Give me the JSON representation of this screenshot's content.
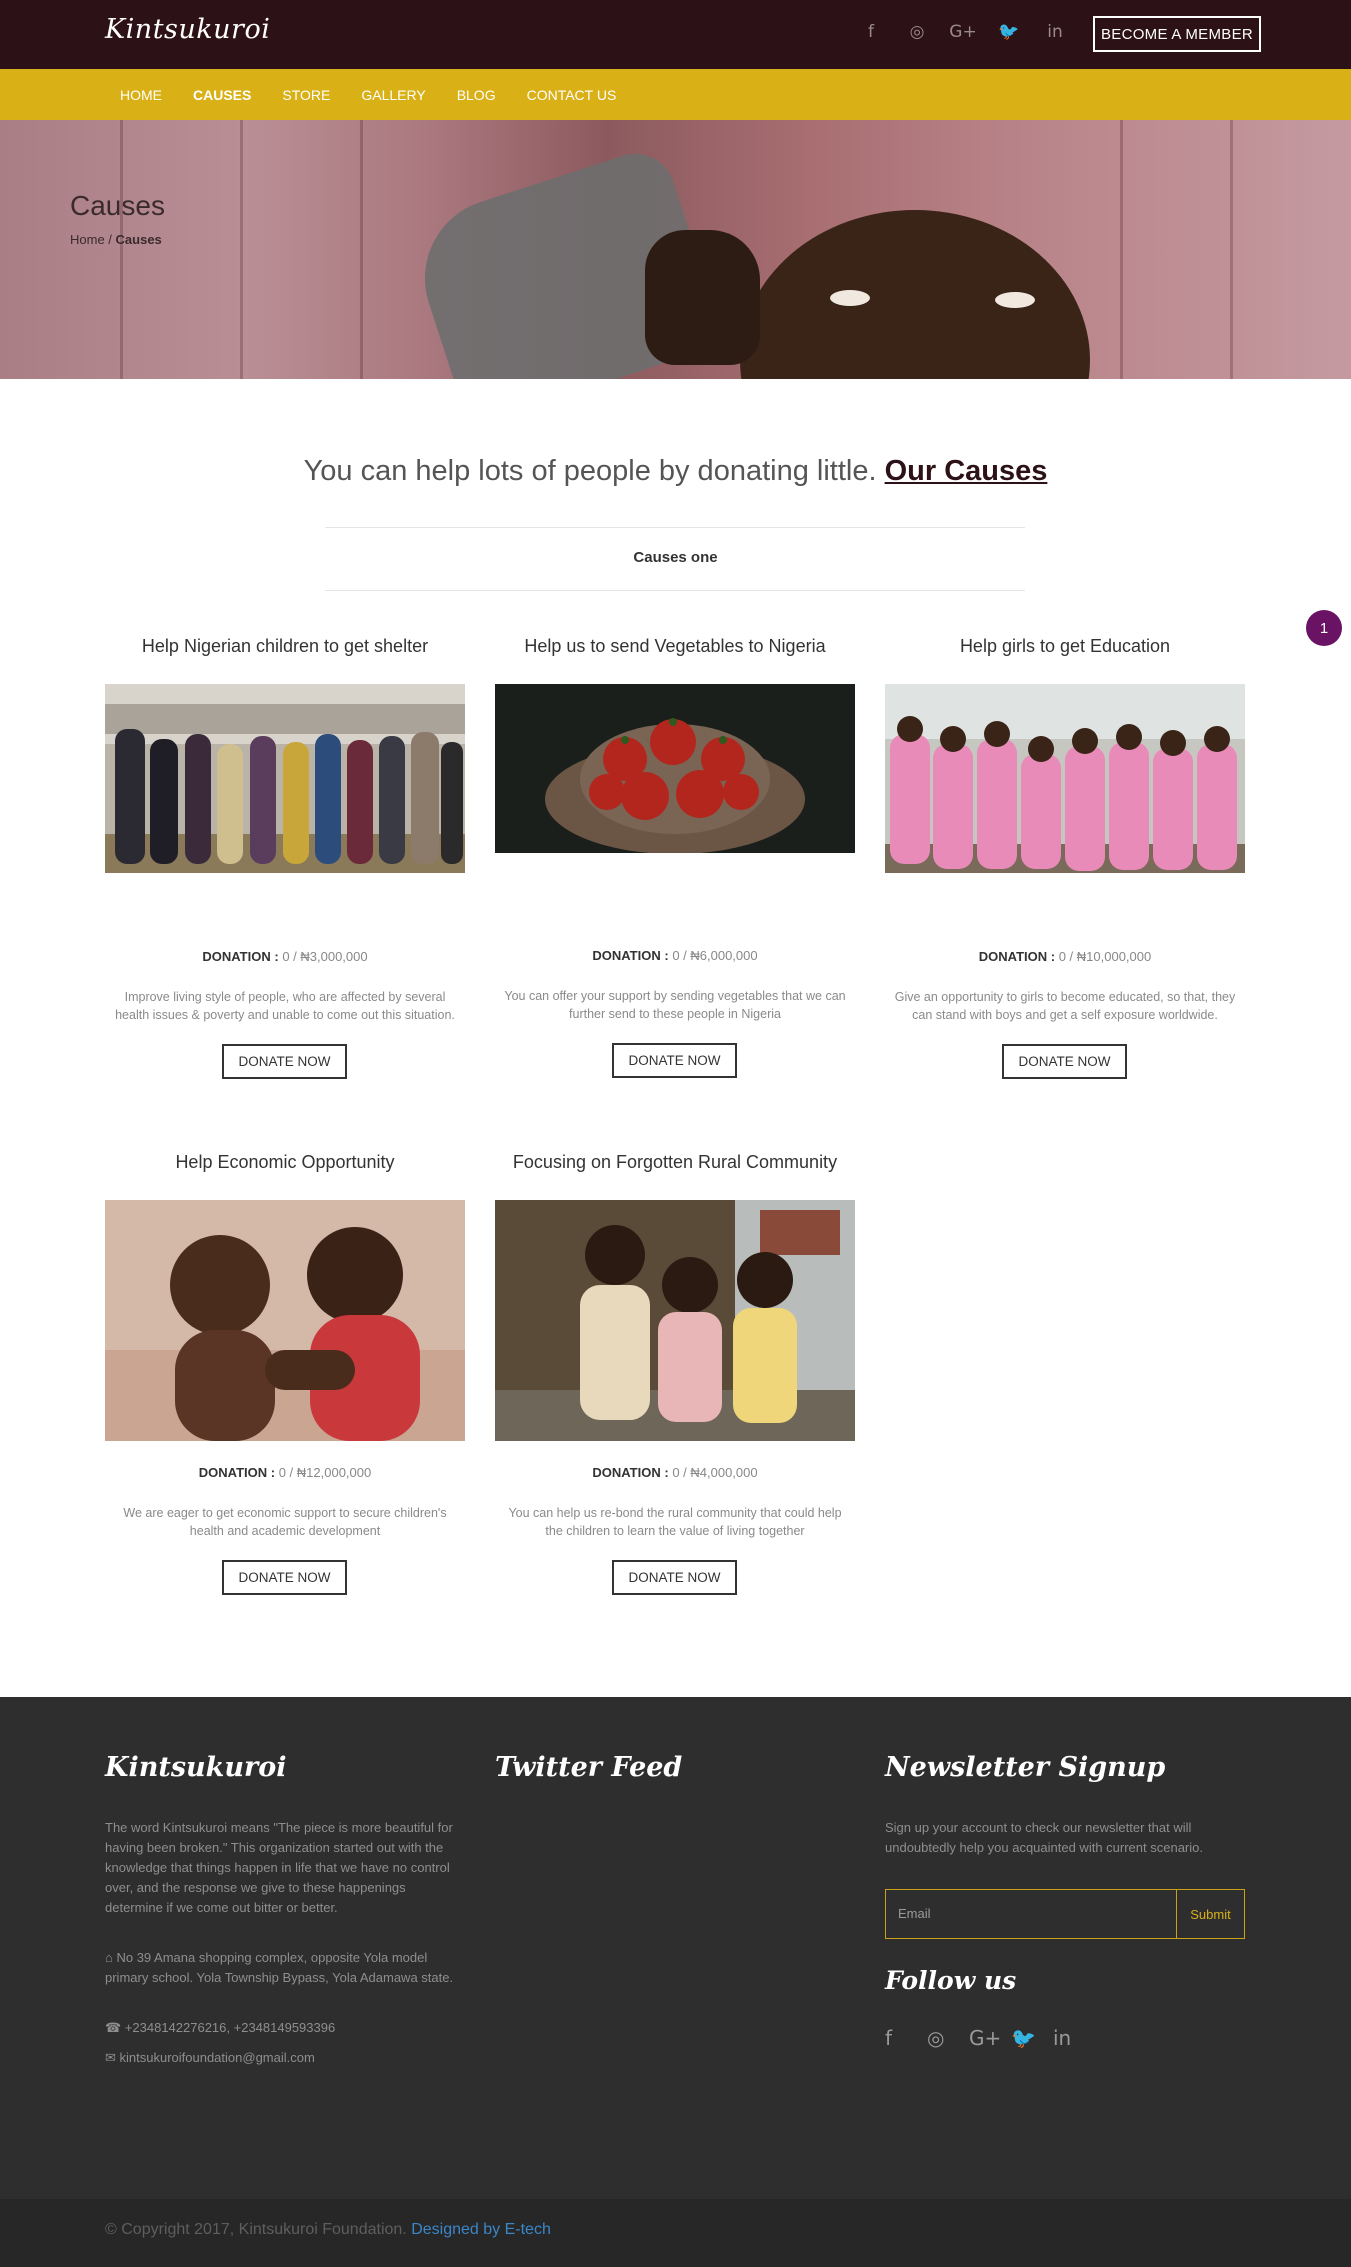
{
  "header": {
    "logo": "Kintsukuroi",
    "social_icons": [
      "facebook-icon",
      "instagram-icon",
      "google-plus-icon",
      "twitter-icon",
      "linkedin-icon"
    ],
    "social_glyphs": [
      "f",
      "◎",
      "G+",
      "🐦",
      "in"
    ],
    "member_button": "BECOME A MEMBER"
  },
  "nav": {
    "items": [
      {
        "label": "HOME"
      },
      {
        "label": "CAUSES"
      },
      {
        "label": "STORE"
      },
      {
        "label": "GALLERY"
      },
      {
        "label": "BLOG"
      },
      {
        "label": "CONTACT US"
      }
    ],
    "active": "CAUSES"
  },
  "hero": {
    "title": "Causes",
    "breadcrumb_home": "Home",
    "breadcrumb_sep": " / ",
    "breadcrumb_current": "Causes"
  },
  "intro": {
    "text": "You can help lots of people by donating little.",
    "link": "Our Causes"
  },
  "section_label": "Causes one",
  "notification_badge": "1",
  "causes": [
    {
      "title": "Help Nigerian children to get shelter",
      "donation_label": "DONATION :",
      "donation_value": "0 / ₦3,000,000",
      "description": "Improve living style of people, who are affected by several health issues & poverty and unable to come out this situation.",
      "button": "DONATE NOW"
    },
    {
      "title": "Help us to send Vegetables to Nigeria",
      "donation_label": "DONATION :",
      "donation_value": "0 / ₦6,000,000",
      "description": "You can offer your support by sending vegetables that we can further send to these people in Nigeria",
      "button": "DONATE NOW"
    },
    {
      "title": "Help girls to get Education",
      "donation_label": "DONATION :",
      "donation_value": "0 / ₦10,000,000",
      "description": "Give an opportunity to girls to become educated, so that, they can stand with boys and get a self exposure worldwide.",
      "button": "DONATE NOW"
    },
    {
      "title": "Help Economic Opportunity",
      "donation_label": "DONATION :",
      "donation_value": "0 / ₦12,000,000",
      "description": "We are eager to get economic support to secure children's health and academic development",
      "button": "DONATE NOW"
    },
    {
      "title": "Focusing on Forgotten Rural Community",
      "donation_label": "DONATION :",
      "donation_value": "0 / ₦4,000,000",
      "description": "You can help us re-bond the rural community that could help the children to learn the value of living together",
      "button": "DONATE NOW"
    }
  ],
  "footer": {
    "about_title": "Kintsukuroi",
    "about_text": "The word Kintsukuroi means \"The piece is more beautiful for having been broken.\" This organization started out with the knowledge that things happen in life that we have no control over, and the response we give to these happenings determine if we come out bitter or better.",
    "address": "No 39 Amana shopping complex, opposite Yola model primary school. Yola Township Bypass, Yola Adamawa state.",
    "phone": "+2348142276216, +2348149593396",
    "email": "kintsukuroifoundation@gmail.com",
    "twitter_title": "Twitter Feed",
    "newsletter_title": "Newsletter Signup",
    "newsletter_text": "Sign up your account to check our newsletter that will undoubtedly help you acquainted with current scenario.",
    "email_placeholder": "Email",
    "submit_label": "Submit",
    "follow_title": "Follow us",
    "social_glyphs": [
      "f",
      "◎",
      "G+",
      "🐦",
      "in"
    ]
  },
  "copyright": {
    "text": "© Copyright 2017, Kintsukuroi Foundation.",
    "link": "Designed by E-tech"
  },
  "colors": {
    "topbar": "#2c1116",
    "navbar": "#d9b016",
    "footer": "#2e2e2e",
    "badge": "#6a1263",
    "link_blue": "#3b86c8"
  }
}
